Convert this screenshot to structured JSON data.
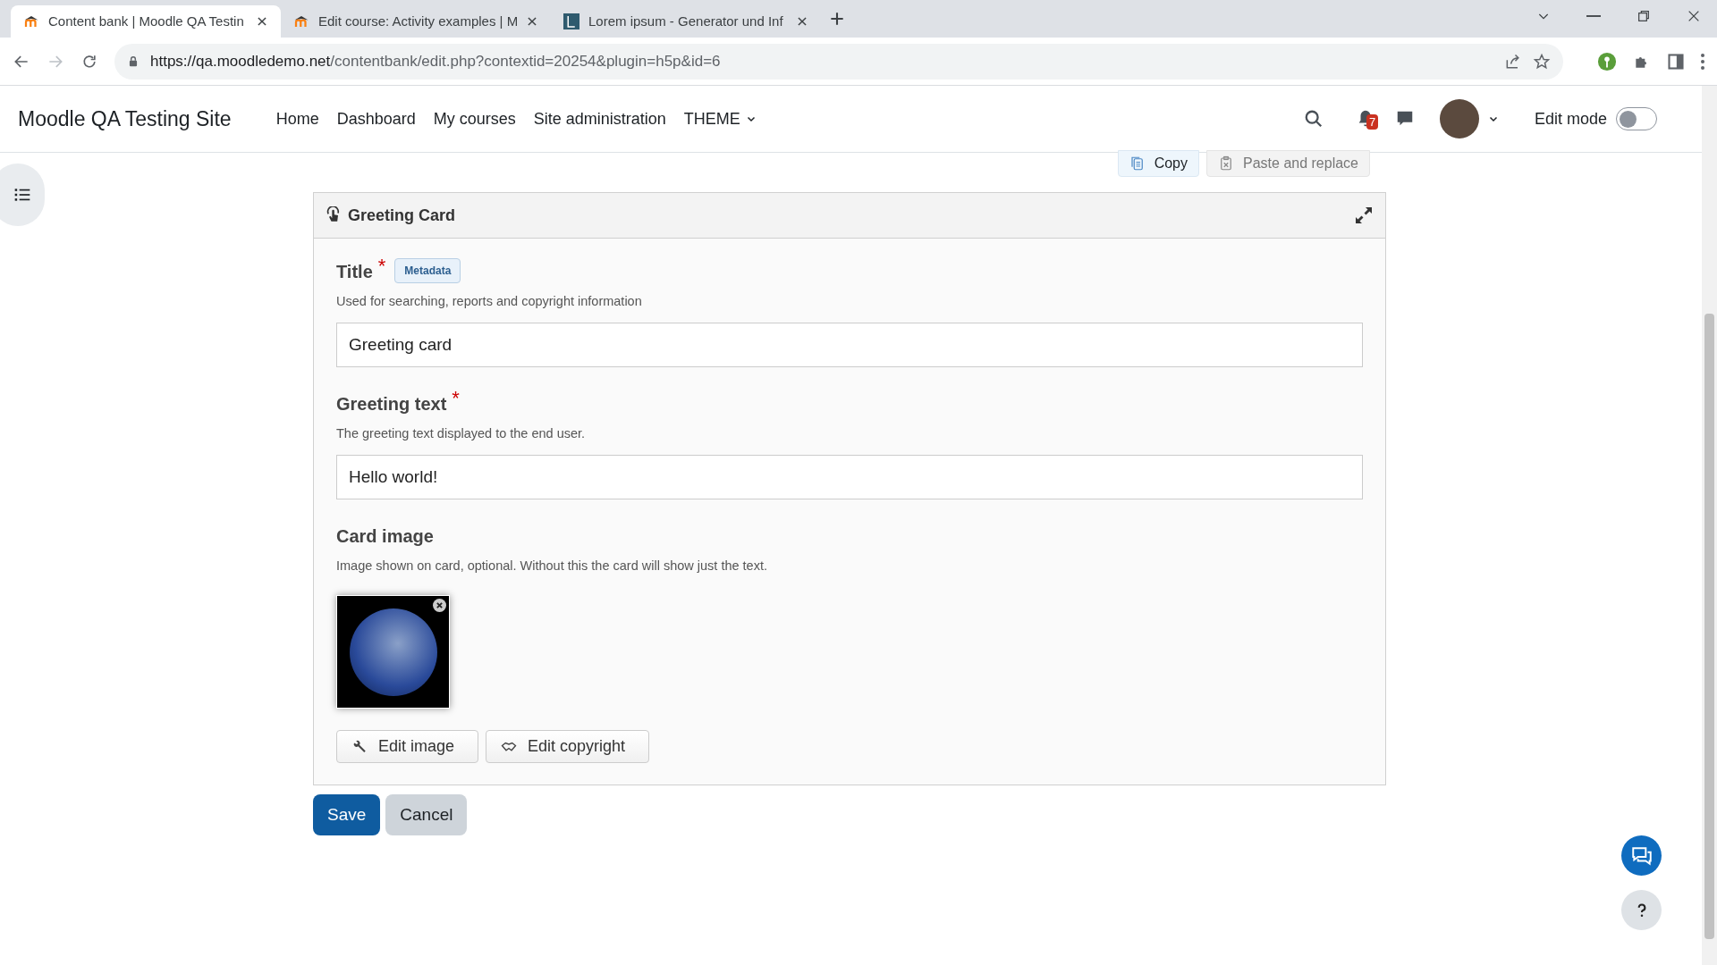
{
  "browser": {
    "tabs": [
      {
        "title": "Content bank | Moodle QA Testin",
        "selected": true
      },
      {
        "title": "Edit course: Activity examples | M",
        "selected": false
      },
      {
        "title": "Lorem ipsum - Generator und Inf",
        "selected": false
      }
    ],
    "address": {
      "host": "https://qa.moodledemo.net",
      "path": "/contentbank/edit.php?contextid=20254&plugin=h5p&id=6"
    }
  },
  "navbar": {
    "site_name": "Moodle QA Testing Site",
    "items": [
      {
        "label": "Home",
        "dropdown": false
      },
      {
        "label": "Dashboard",
        "dropdown": false
      },
      {
        "label": "My courses",
        "dropdown": false
      },
      {
        "label": "Site administration",
        "dropdown": false
      },
      {
        "label": "THEME",
        "dropdown": true
      }
    ],
    "notification_count": "7",
    "edit_mode": {
      "label": "Edit mode",
      "on": false
    }
  },
  "toolbar": [
    {
      "label": "Copy",
      "disabled": false
    },
    {
      "label": "Paste and replace",
      "disabled": true
    }
  ],
  "card": {
    "title": "Greeting Card",
    "fields": [
      {
        "kind": "text",
        "label": "Title",
        "required_mark": "*",
        "badge": "Metadata",
        "description": "Used for searching, reports and copyright information",
        "value": "Greeting card"
      },
      {
        "kind": "text",
        "label": "Greeting text",
        "required_mark": "*",
        "description": "The greeting text displayed to the end user.",
        "value": "Hello world!"
      },
      {
        "kind": "image",
        "label": "Card image",
        "description": "Image shown on card, optional. Without this the card will show just the text.",
        "buttons": [
          "Edit image",
          "Edit copyright"
        ]
      }
    ]
  },
  "actions": [
    {
      "label": "Save",
      "primary": true
    },
    {
      "label": "Cancel",
      "primary": false
    }
  ]
}
